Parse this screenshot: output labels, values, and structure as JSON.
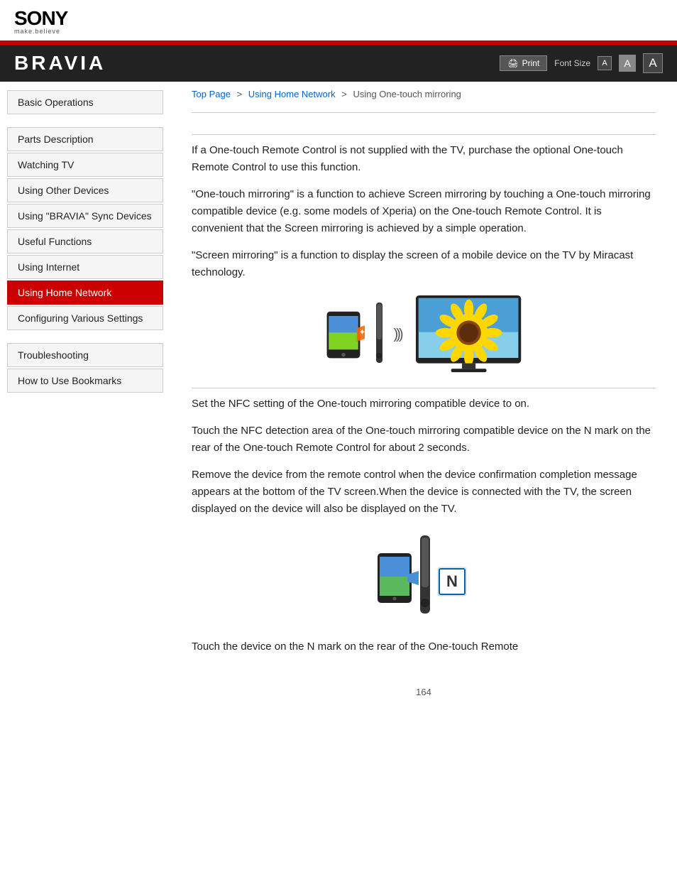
{
  "header": {
    "sony_text": "SONY",
    "tagline": "make.believe",
    "bravia_title": "BRAVIA",
    "print_label": "Print",
    "font_size_label": "Font Size",
    "font_btn_s": "A",
    "font_btn_m": "A",
    "font_btn_l": "A"
  },
  "breadcrumb": {
    "top_page": "Top Page",
    "using_home_network": "Using Home Network",
    "current": "Using One-touch mirroring",
    "sep1": ">",
    "sep2": ">"
  },
  "sidebar": {
    "items": [
      {
        "id": "basic-operations",
        "label": "Basic Operations",
        "active": false
      },
      {
        "id": "parts-description",
        "label": "Parts Description",
        "active": false
      },
      {
        "id": "watching-tv",
        "label": "Watching TV",
        "active": false
      },
      {
        "id": "using-other-devices",
        "label": "Using Other Devices",
        "active": false
      },
      {
        "id": "using-bravia-sync",
        "label": "Using \"BRAVIA\" Sync Devices",
        "active": false
      },
      {
        "id": "useful-functions",
        "label": "Useful Functions",
        "active": false
      },
      {
        "id": "using-internet",
        "label": "Using Internet",
        "active": false
      },
      {
        "id": "using-home-network",
        "label": "Using Home Network",
        "active": true
      },
      {
        "id": "configuring-settings",
        "label": "Configuring Various Settings",
        "active": false
      }
    ],
    "items2": [
      {
        "id": "troubleshooting",
        "label": "Troubleshooting",
        "active": false
      },
      {
        "id": "how-to-use-bookmarks",
        "label": "How to Use Bookmarks",
        "active": false
      }
    ]
  },
  "content": {
    "para1": "If a One-touch Remote Control is not supplied with the TV, purchase the optional One-touch Remote Control to use this function.",
    "para2": "\"One-touch mirroring\" is a function to achieve Screen mirroring by touching a One-touch mirroring compatible device (e.g. some models of Xperia) on the One-touch Remote Control. It is convenient that the Screen mirroring is achieved by a simple operation.",
    "para3": "\"Screen mirroring\" is a function to display the screen of a mobile device on the TV by Miracast technology.",
    "para4": "Set the NFC setting of the One-touch mirroring compatible device to on.",
    "para5": "Touch the NFC detection area of the One-touch mirroring compatible device on the N mark on the rear of the One-touch Remote Control for about 2 seconds.",
    "para6": "Remove the device from the remote control when the device confirmation completion message appears at the bottom of the TV screen.When the device is connected with the TV, the screen displayed on the device will also be displayed on the TV.",
    "para7": "Touch the device on the N mark on the rear of the One-touch Remote",
    "page_number": "164"
  }
}
